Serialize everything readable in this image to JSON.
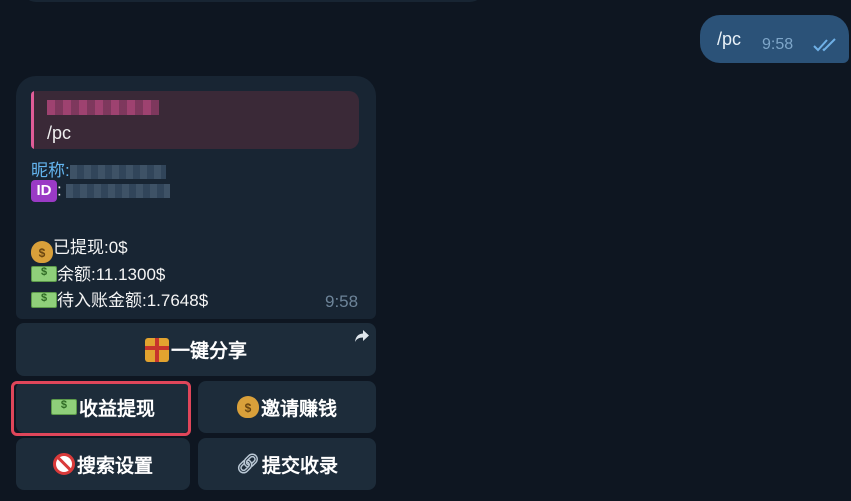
{
  "outgoing": {
    "text": "/pc",
    "time": "9:58",
    "status_icon": "double-check-icon"
  },
  "incoming": {
    "reply_quote_text": "/pc",
    "nickname_label": "昵称:",
    "id_label_suffix": ":",
    "withdrawn": "已提现:0$",
    "balance": "余额:11.1300$",
    "pending": "待入账金额:1.7648$",
    "time": "9:58"
  },
  "keyboard": {
    "share": "一键分享",
    "withdraw": "收益提现",
    "invite": "邀请赚钱",
    "search_settings": "搜索设置",
    "submit_records": "提交收录"
  },
  "colors": {
    "background": "#0e1621",
    "bubble_in": "#182533",
    "bubble_out": "#2b5278",
    "highlight": "#e0465a",
    "link": "#64b5ef"
  }
}
